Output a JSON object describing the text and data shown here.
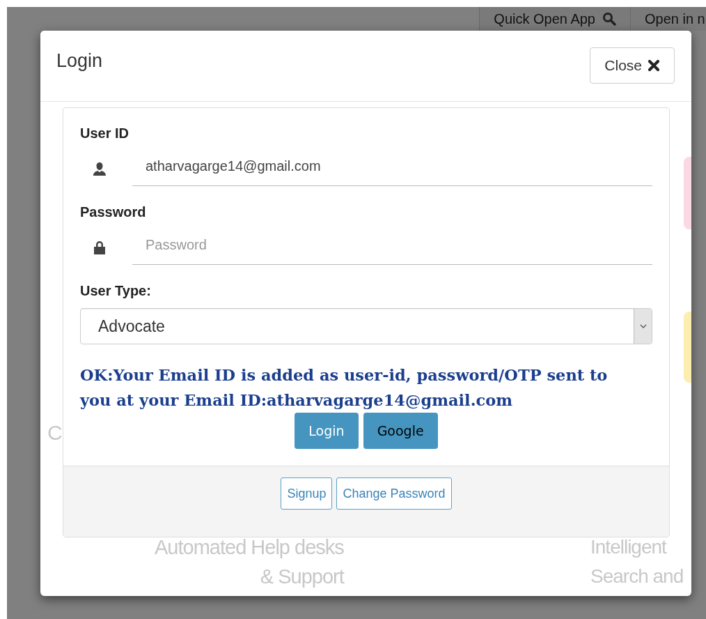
{
  "top_bar": {
    "buttons": [
      {
        "label": "Quick Open App"
      },
      {
        "label": "Open in n"
      }
    ]
  },
  "background_texts": [
    "C",
    "Automated Help desks\n& Support",
    "Intelligent\nSearch and"
  ],
  "background_tiles": [
    {
      "color": "#fbd9e4"
    },
    {
      "color": "#fbeeb0"
    }
  ],
  "modal": {
    "title": "Login",
    "close_button": "Close",
    "fields": [
      {
        "kind": "text",
        "label": "User ID",
        "value": "atharvagarge14@gmail.com"
      },
      {
        "kind": "password",
        "label": "Password",
        "placeholder": "Password"
      },
      {
        "kind": "select",
        "label": "User Type:",
        "value": "Advocate"
      }
    ],
    "message": "OK:Your Email ID is added as user-id, password/OTP sent to you at your Email ID:atharvagarge14@gmail.com",
    "buttons": [
      {
        "label": "Login",
        "kind": "light"
      },
      {
        "label": "Google",
        "kind": "dark"
      }
    ],
    "footer_buttons": [
      "Signup",
      "Change Password"
    ]
  }
}
